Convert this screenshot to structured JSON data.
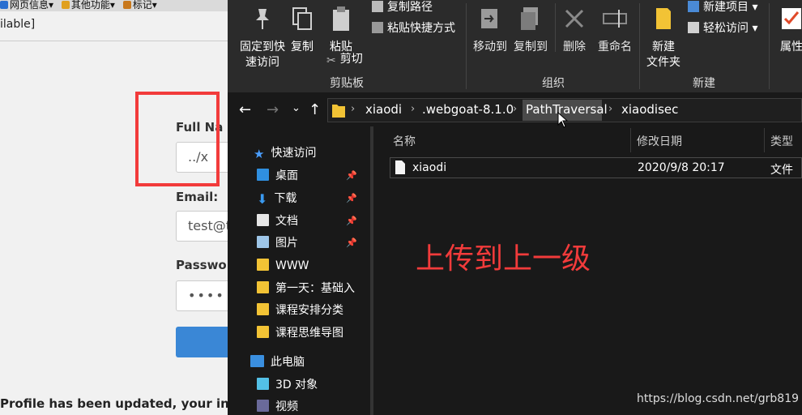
{
  "browser": {
    "bookmarks": [
      "网页信息▾",
      "其他功能▾",
      "标记▾"
    ],
    "status_strip": "ilable]",
    "fields": [
      {
        "label": "Full Na",
        "value": "../x"
      },
      {
        "label": "Email:",
        "value": "test@t"
      },
      {
        "label": "Passwo",
        "value": "••••"
      }
    ],
    "message": "Profile has been updated, your in"
  },
  "ribbon": {
    "clipboard": {
      "pin_label": "固定到快\n速访问",
      "copy_label": "复制",
      "paste_label": "粘贴",
      "copy_path": "复制路径",
      "paste_shortcut": "粘贴快捷方式",
      "cut": "剪切",
      "group": "剪贴板"
    },
    "organize": {
      "move_to": "移动到",
      "copy_to": "复制到",
      "delete": "删除",
      "rename": "重命名",
      "group": "组织"
    },
    "new": {
      "new_folder": "新建\n文件夹",
      "new_item": "新建项目 ▾",
      "easy_access": "轻松访问 ▾",
      "group": "新建"
    },
    "open": {
      "properties": "属性"
    }
  },
  "nav": {
    "back": "←",
    "forward": "→",
    "recent": "⌄",
    "up": "↑"
  },
  "breadcrumbs": [
    "xiaodi",
    ".webgoat-8.1.0",
    "PathTraversal",
    "xiaodisec"
  ],
  "navpane": {
    "quick_access": "快速访问",
    "items": [
      {
        "label": "桌面",
        "icon": "desktop-icon",
        "pinned": true
      },
      {
        "label": "下载",
        "icon": "download-icon",
        "pinned": true
      },
      {
        "label": "文档",
        "icon": "documents-icon",
        "pinned": true
      },
      {
        "label": "图片",
        "icon": "pictures-icon",
        "pinned": true
      },
      {
        "label": "WWW",
        "icon": "folder-icon",
        "pinned": false
      },
      {
        "label": "第一天：基础入",
        "icon": "folder-icon",
        "pinned": false
      },
      {
        "label": "课程安排分类",
        "icon": "folder-icon",
        "pinned": false
      },
      {
        "label": "课程思维导图",
        "icon": "folder-icon",
        "pinned": false
      }
    ],
    "this_pc": "此电脑",
    "pc_items": [
      {
        "label": "3D 对象",
        "icon": "3d-objects-icon"
      },
      {
        "label": "视频",
        "icon": "video-icon"
      }
    ]
  },
  "columns": {
    "name": "名称",
    "modified": "修改日期",
    "type": "类型"
  },
  "files": [
    {
      "name": "xiaodi",
      "modified": "2020/9/8 20:17",
      "type": "文件"
    }
  ],
  "annotation": "上传到上一级",
  "watermark": "https://blog.csdn.net/grb819",
  "colors": {
    "annotation_red": "#f23b3b",
    "explorer_bg": "#191919",
    "ribbon_bg": "#2b2b2b",
    "web_button": "#3a87d6"
  }
}
